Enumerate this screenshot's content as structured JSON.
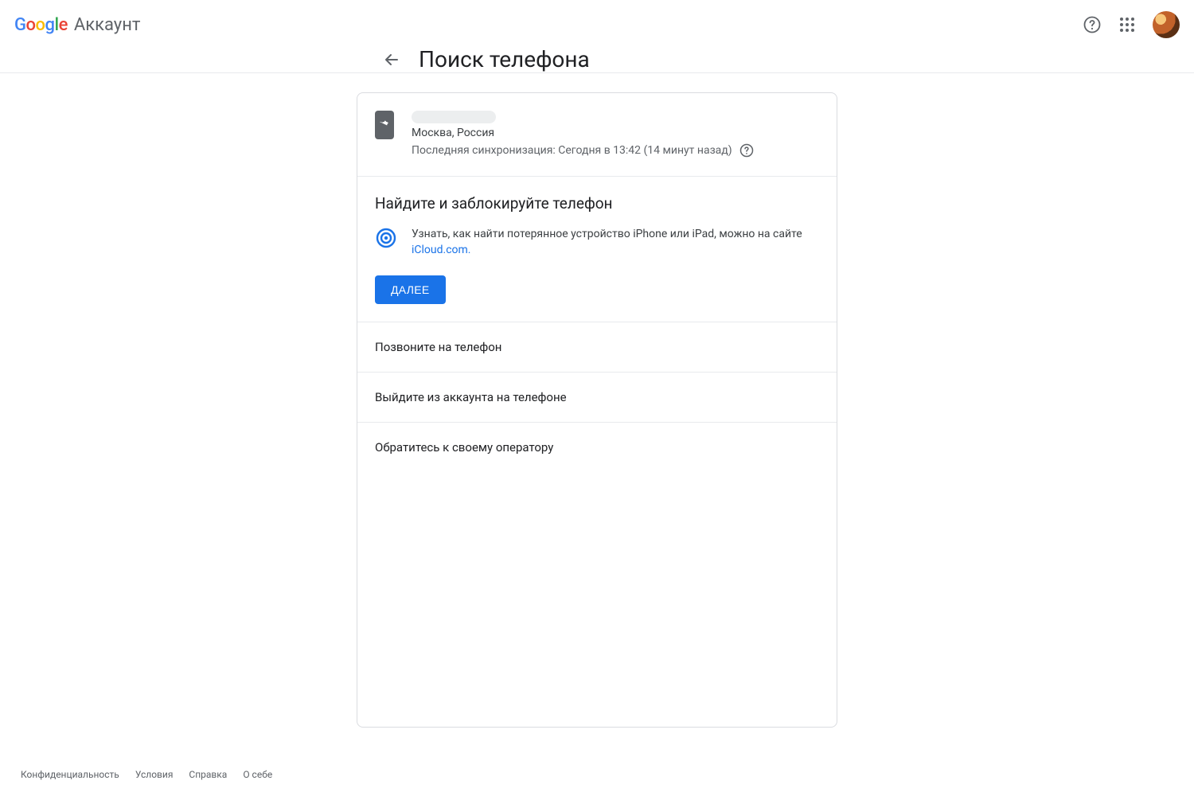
{
  "header": {
    "brand_sub": "Аккаунт"
  },
  "title": {
    "page_title": "Поиск телефона"
  },
  "device": {
    "location": "Москва, Россия",
    "sync_line": "Последняя синхронизация: Сегодня в 13:42 (14 минут назад)"
  },
  "find": {
    "section_title": "Найдите и заблокируйте телефон",
    "info_text": "Узнать, как найти потерянное устройство iPhone или iPad, можно на сайте ",
    "link_text": "iCloud.com.",
    "next_btn": "ДАЛЕЕ"
  },
  "actions": {
    "call": "Позвоните на телефон",
    "signout": "Выйдите из аккаунта на телефоне",
    "carrier": "Обратитесь к своему оператору"
  },
  "footer": {
    "privacy": "Конфиденциальность",
    "terms": "Условия",
    "help": "Справка",
    "about": "О себе"
  }
}
